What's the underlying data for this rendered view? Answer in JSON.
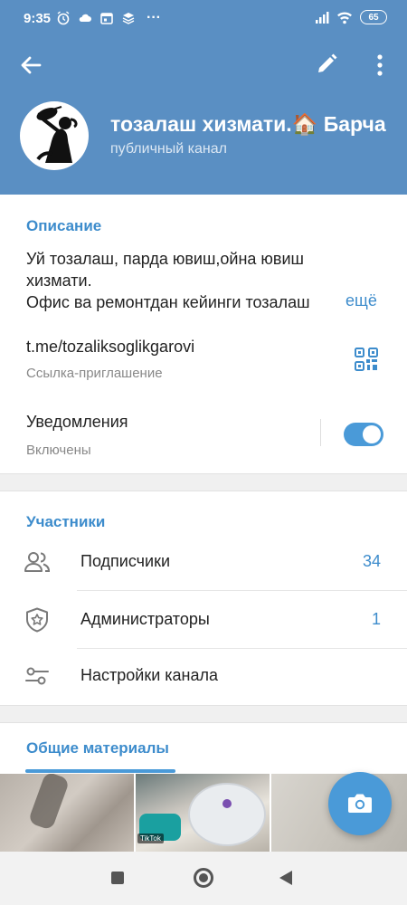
{
  "status_bar": {
    "time": "9:35",
    "battery": "65",
    "more_dots": "···"
  },
  "header": {
    "channel_name": "тозалаш хизмати.🏠  Барча",
    "channel_type": "публичный канал"
  },
  "description": {
    "title": "Описание",
    "line1": "Уй тозалаш, парда ювиш,ойна ювиш",
    "line2": "хизмати.",
    "line3": "Офис ва ремонтдан кейинги  тозалаш",
    "more": "ещё"
  },
  "invite_link": {
    "value": "t.me/tozaliksoglikgarovi",
    "label": "Ссылка-приглашение"
  },
  "notifications": {
    "label": "Уведомления",
    "status": "Включены",
    "enabled": true
  },
  "members": {
    "title": "Участники",
    "rows": [
      {
        "label": "Подписчики",
        "value": "34",
        "icon": "people-icon"
      },
      {
        "label": "Администраторы",
        "value": "1",
        "icon": "shield-star-icon"
      },
      {
        "label": "Настройки канала",
        "value": "",
        "icon": "sliders-icon"
      }
    ]
  },
  "shared_media": {
    "title": "Общие материалы",
    "tiktok_label": "TikTok"
  },
  "colors": {
    "header_bg": "#5a8fc3",
    "accent": "#3d8ccc"
  }
}
